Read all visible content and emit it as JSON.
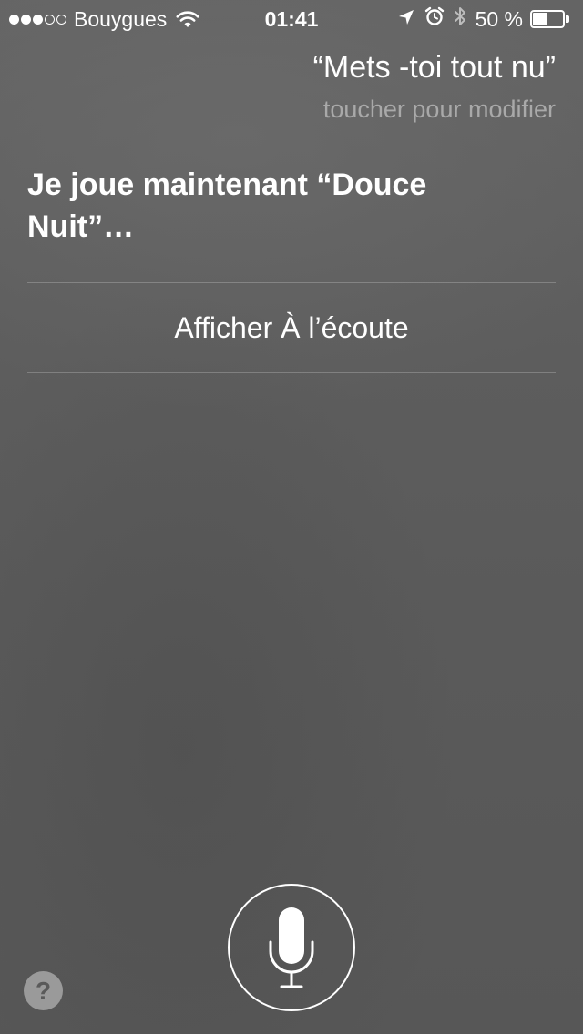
{
  "status_bar": {
    "signal_bars_filled": 3,
    "signal_bars_total": 5,
    "carrier": "Bouygues",
    "time": "01:41",
    "battery_percent_label": "50 %",
    "battery_level": 0.5,
    "icons": [
      "wifi-icon",
      "location-arrow-icon",
      "alarm-clock-icon",
      "bluetooth-icon",
      "battery-icon"
    ]
  },
  "siri": {
    "query": "“Mets -toi tout nu”",
    "edit_hint": "toucher pour modifier",
    "response": "Je joue maintenant “Douce Nuit”…",
    "action_label": "Afficher À l’écoute"
  },
  "controls": {
    "mic_icon": "microphone-icon",
    "help_label": "?"
  }
}
